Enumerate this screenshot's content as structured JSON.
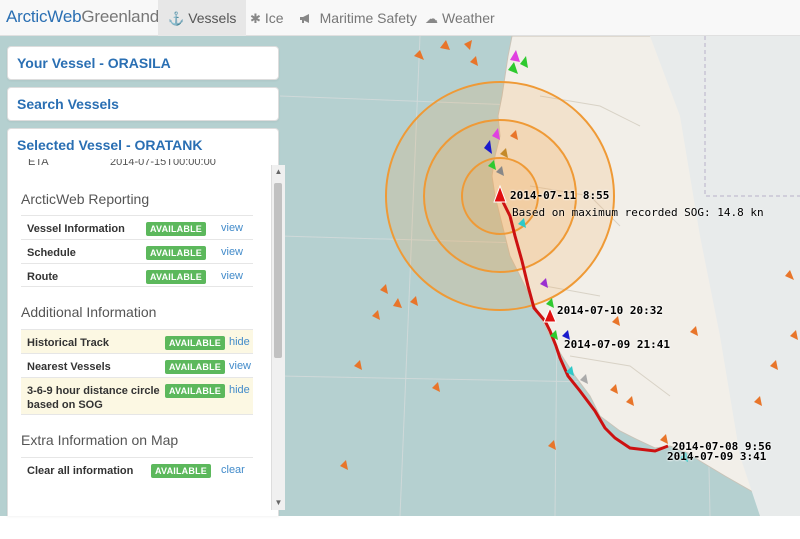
{
  "brand": {
    "part1": "ArcticWeb",
    "part2": "Greenland"
  },
  "nav": [
    {
      "label": "Vessels",
      "icon": "anchor-icon",
      "glyph": "⚓"
    },
    {
      "label": "Ice",
      "icon": "snowflake-icon",
      "glyph": "✱"
    },
    {
      "label": "Maritime Safety",
      "icon": "bullhorn-icon",
      "glyph": "📢"
    },
    {
      "label": "Weather",
      "icon": "cloud-icon",
      "glyph": "☁"
    }
  ],
  "panels": {
    "your_vessel": "Your Vessel - ORASILA",
    "search": "Search Vessels",
    "selected": "Selected Vessel - ORATANK"
  },
  "eta": {
    "label": "ETA",
    "value": "2014-07-15T00:00:00"
  },
  "reporting": {
    "heading": "ArcticWeb Reporting",
    "rows": [
      {
        "label": "Vessel Information",
        "status": "AVAILABLE",
        "action": "view"
      },
      {
        "label": "Schedule",
        "status": "AVAILABLE",
        "action": "view"
      },
      {
        "label": "Route",
        "status": "AVAILABLE",
        "action": "view"
      }
    ]
  },
  "additional": {
    "heading": "Additional Information",
    "rows": [
      {
        "label": "Historical Track",
        "status": "AVAILABLE",
        "action": "hide"
      },
      {
        "label": "Nearest Vessels",
        "status": "AVAILABLE",
        "action": "view"
      },
      {
        "label_line1": "3-6-9 hour distance circle",
        "label_line2": "based on SOG",
        "status": "AVAILABLE",
        "action": "hide"
      }
    ]
  },
  "extra": {
    "heading": "Extra Information on Map",
    "rows": [
      {
        "label": "Clear all information",
        "status": "AVAILABLE",
        "action": "clear"
      }
    ]
  },
  "map_labels": {
    "current": "2014-07-11 8:55",
    "sog_note": "Based on maximum recorded SOG: 14.8 kn",
    "t1": "2014-07-10 20:32",
    "t2": "2014-07-09 21:41",
    "t3": "2014-07-08 9:56",
    "t4": "2014-07-09 3:41"
  },
  "colors": {
    "accent": "#2a6fb3",
    "available": "#5cb85c",
    "sea": "#b5d0d0",
    "land": "#f2efe9",
    "track": "#cc1111",
    "circle": "#f0a040"
  }
}
